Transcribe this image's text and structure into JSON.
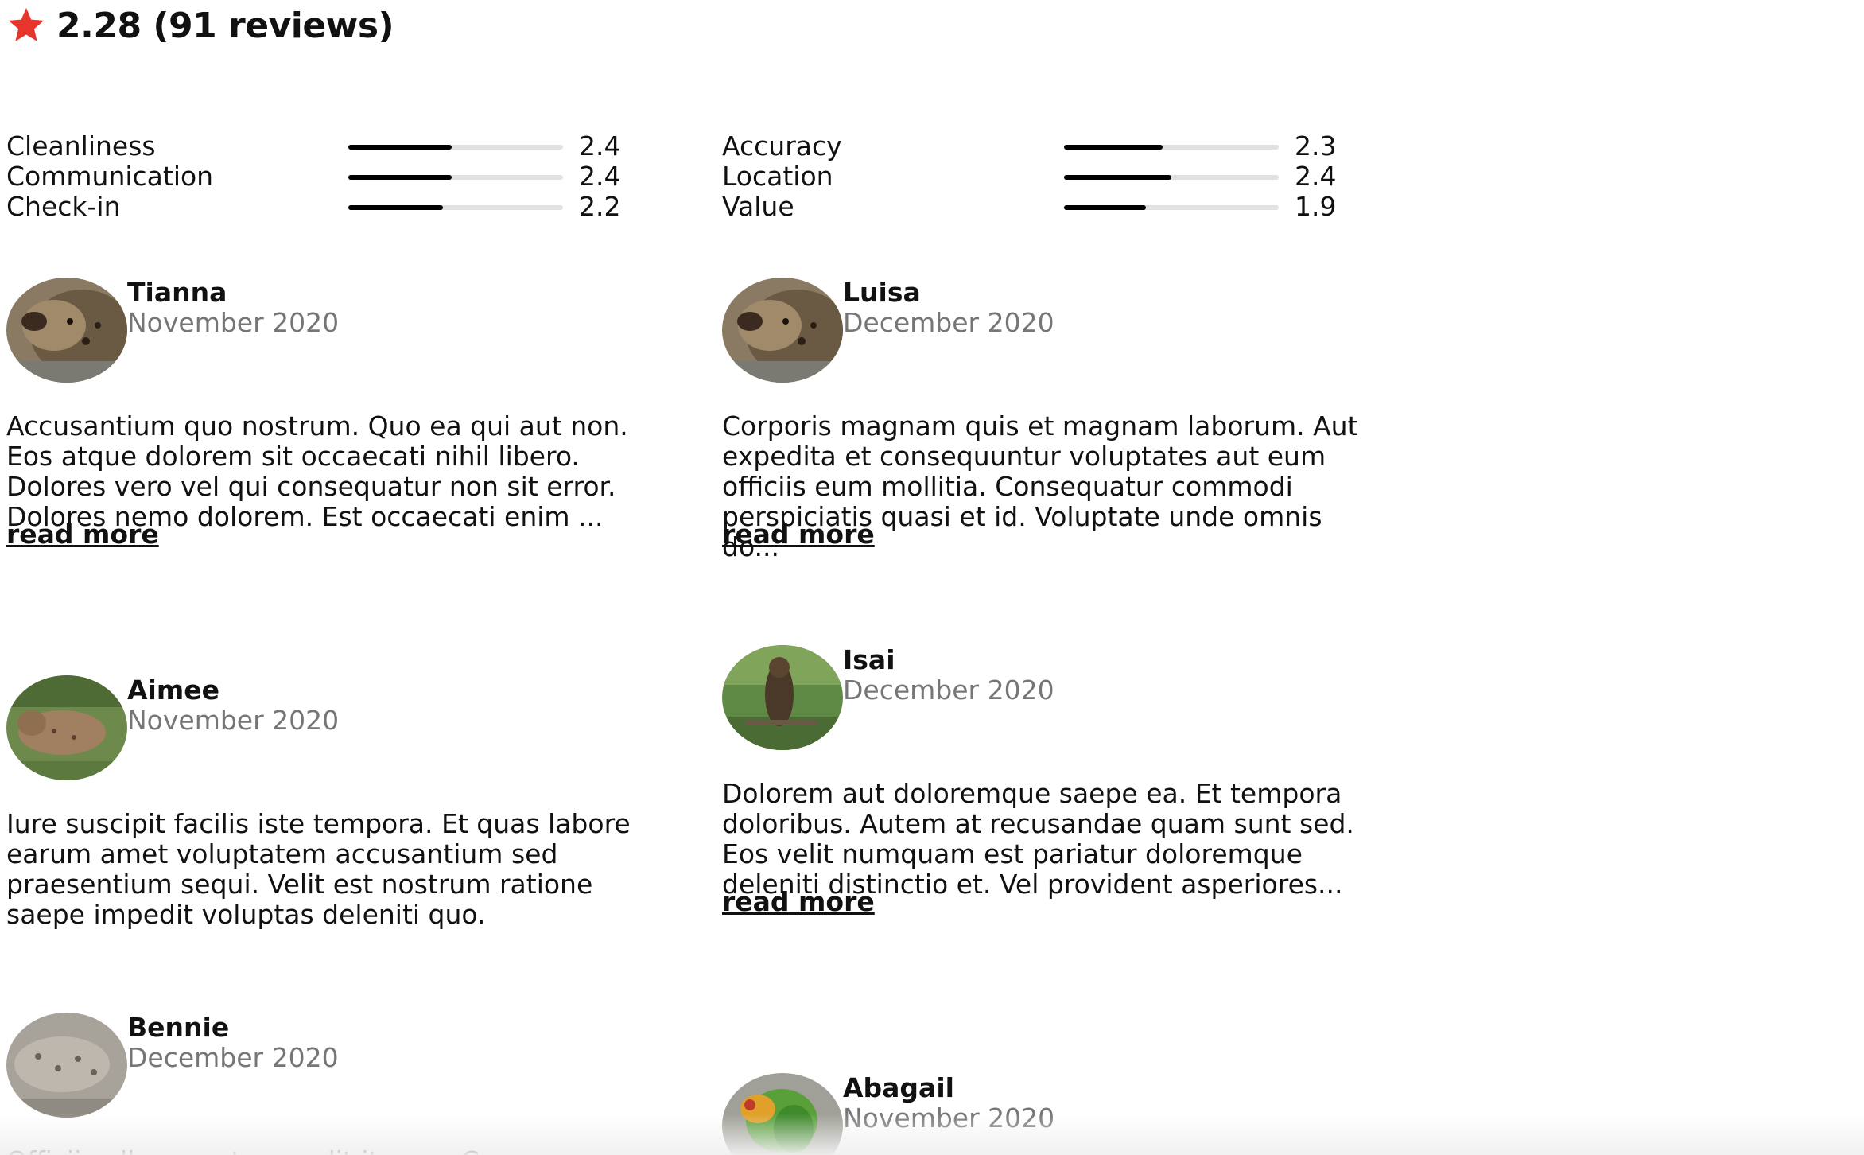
{
  "header": {
    "title": "2.28 (91 reviews)",
    "star_icon": "star-icon",
    "star_color": "#e8352b"
  },
  "scores": [
    {
      "label": "Cleanliness",
      "value": "2.4",
      "level": 0.48
    },
    {
      "label": "Communication",
      "value": "2.4",
      "level": 0.48
    },
    {
      "label": "Check-in",
      "value": "2.2",
      "level": 0.44
    },
    {
      "label": "Accuracy",
      "value": "2.3",
      "level": 0.46
    },
    {
      "label": "Location",
      "value": "2.4",
      "level": 0.5
    },
    {
      "label": "Value",
      "value": "1.9",
      "level": 0.38
    }
  ],
  "reviews": [
    {
      "name": "Tianna",
      "date": "November 2020",
      "text": "Accusantium quo nostrum. Quo ea qui aut non. Eos atque dolorem sit occaecati nihil libero. Dolores vero vel qui consequatur non sit error. Dolores nemo dolorem. Est occaecati enim ...",
      "read_more": "read more",
      "avatar_icon": "hyena-avatar"
    },
    {
      "name": "Luisa",
      "date": "December 2020",
      "text": "Corporis magnam quis et magnam laborum. Aut expedita et consequuntur voluptates aut eum officiis eum mollitia. Consequatur commodi perspiciatis quasi et id. Voluptate unde omnis do...",
      "read_more": "read more",
      "avatar_icon": "hyena-avatar"
    },
    {
      "name": "Aimee",
      "date": "November 2020",
      "text": "Iure suscipit facilis iste tempora. Et quas labore earum amet voluptatem accusantium sed praesentium sequi. Velit est nostrum ratione saepe impedit voluptas deleniti quo.",
      "avatar_icon": "lynx-avatar"
    },
    {
      "name": "Isai",
      "date": "December 2020",
      "text": "Dolorem aut doloremque saepe ea. Et tempora doloribus. Autem at recusandae quam sunt sed. Eos velit numquam est pariatur doloremque deleniti distinctio et. Vel provident asperiores...",
      "read_more": "read more",
      "avatar_icon": "owl-avatar"
    },
    {
      "name": "Bennie",
      "date": "December 2020",
      "text": "Officiis ullam nostrum odit itaque. Cumque",
      "avatar_icon": "leopard-avatar"
    },
    {
      "name": "Abagail",
      "date": "November 2020",
      "avatar_icon": "parrot-avatar"
    }
  ]
}
